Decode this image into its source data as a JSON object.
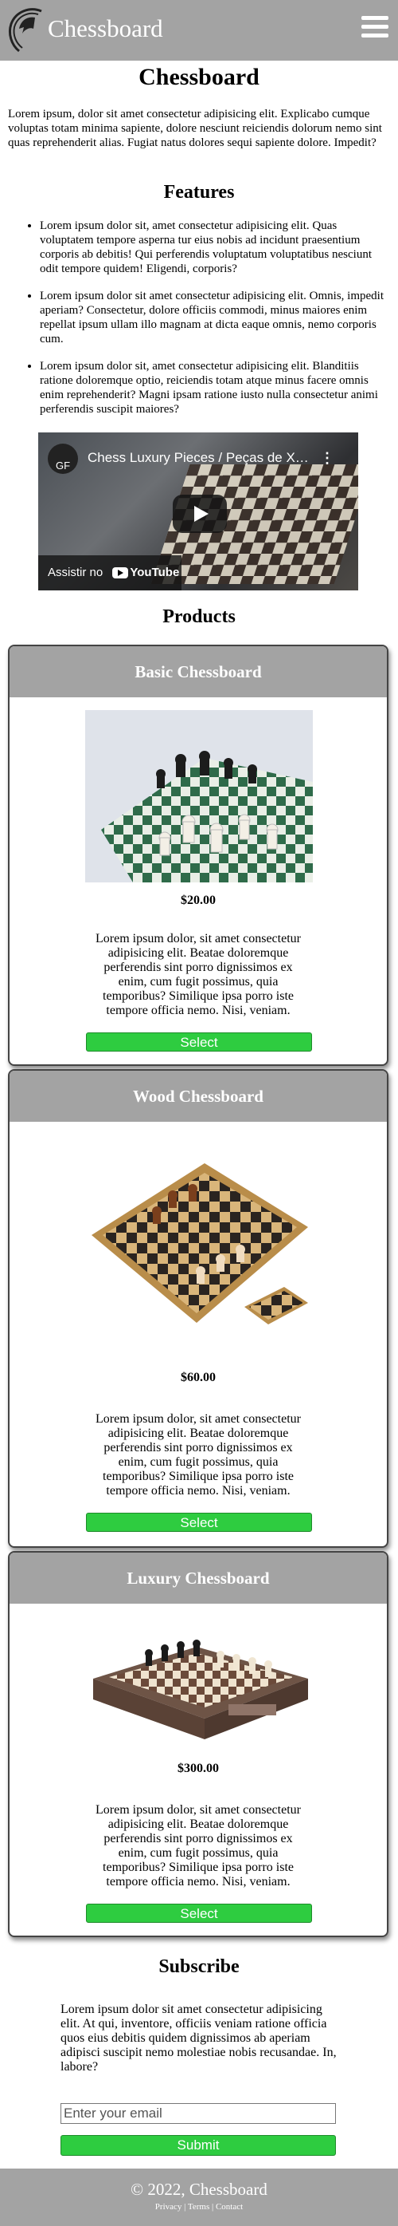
{
  "header": {
    "brand": "Chessboard",
    "logo_icon": "knight-logo-icon",
    "menu_icon": "hamburger-menu-icon"
  },
  "page": {
    "title": "Chessboard",
    "intro": "Lorem ipsum, dolor sit amet consectetur adipisicing elit. Explicabo cumque voluptas totam minima sapiente, dolore nesciunt reiciendis dolorum nemo sint quas reprehenderit alias. Fugiat natus dolores sequi sapiente dolore. Impedit?"
  },
  "features": {
    "title": "Features",
    "items": [
      "Lorem ipsum dolor sit, amet consectetur adipisicing elit. Quas voluptatem tempore asperna tur eius nobis ad incidunt praesentium corporis ab debitis! Qui perferendis voluptatum voluptatibus nesciunt odit tempore quidem! Eligendi, corporis?",
      "Lorem ipsum dolor sit amet consectetur adipisicing elit. Omnis, impedit aperiam? Consectetur, dolore officiis commodi, minus maiores enim repellat ipsum ullam illo magnam at dicta eaque omnis, nemo corporis cum.",
      "Lorem ipsum dolor sit, amet consectetur adipisicing elit. Blanditiis ratione doloremque optio, reiciendis totam atque minus facere omnis enim reprehenderit? Magni ipsam ratione iusto nulla consectetur animi perferendis suscipit maiores?"
    ]
  },
  "video": {
    "title": "Chess Luxury Pieces / Peças de Xadrez de Luxo",
    "channel_initials": "GF",
    "watch_on": "Assistir no",
    "youtube": "YouTube"
  },
  "products": {
    "title": "Products",
    "items": [
      {
        "name": "Basic Chessboard",
        "price": "$20.00",
        "description": "Lorem ipsum dolor, sit amet consectetur adipisicing elit. Beatae doloremque perferendis sint porro dignissimos ex enim, cum fugit possimus, quia temporibus? Similique ipsa porro iste tempore officia nemo. Nisi, veniam.",
        "button": "Select"
      },
      {
        "name": "Wood Chessboard",
        "price": "$60.00",
        "description": "Lorem ipsum dolor, sit amet consectetur adipisicing elit. Beatae doloremque perferendis sint porro dignissimos ex enim, cum fugit possimus, quia temporibus? Similique ipsa porro iste tempore officia nemo. Nisi, veniam.",
        "button": "Select"
      },
      {
        "name": "Luxury Chessboard",
        "price": "$300.00",
        "description": "Lorem ipsum dolor, sit amet consectetur adipisicing elit. Beatae doloremque perferendis sint porro dignissimos ex enim, cum fugit possimus, quia temporibus? Similique ipsa porro iste tempore officia nemo. Nisi, veniam.",
        "button": "Select"
      }
    ]
  },
  "subscribe": {
    "title": "Subscribe",
    "text": "Lorem ipsum dolor sit amet consectetur adipisicing elit. At qui, inventore, officiis veniam ratione officia quos eius debitis quidem dignissimos ab aperiam adipisci suscipit nemo molestiae nobis recusandae. In, labore?",
    "email_placeholder": "Enter your email",
    "submit": "Submit"
  },
  "footer": {
    "copyright": "© 2022, Chessboard",
    "links": [
      "Privacy",
      "Terms",
      "Contact"
    ],
    "separator": "|"
  },
  "colors": {
    "header_bg": "#a3a3a3",
    "button_green": "#2ecc40"
  }
}
